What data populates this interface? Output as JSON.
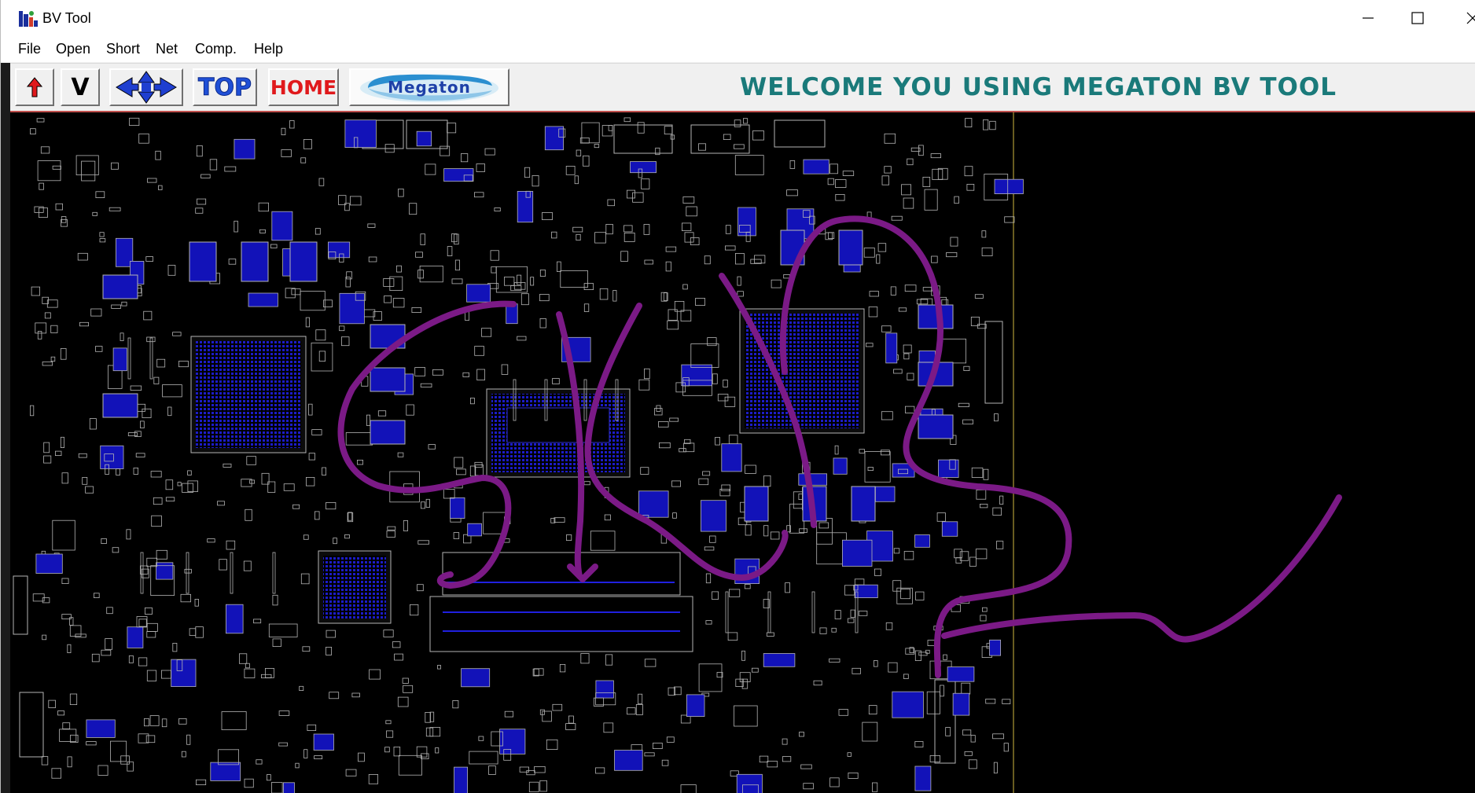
{
  "window": {
    "title": "BV Tool",
    "controls": {
      "minimize": "—",
      "maximize": "☐",
      "close": "✕"
    }
  },
  "menu": [
    "File",
    "Open",
    "Short",
    "Net",
    "Comp.",
    "Help"
  ],
  "toolbar": {
    "up_icon": "up-arrow-icon",
    "v_label": "V",
    "nav_icon": "four-way-arrows-icon",
    "top_label": "TOP",
    "home_label": "HOME",
    "logo_text": "Megaton",
    "welcome": "WELCOME YOU USING MEGATON BV TOOL"
  },
  "colors": {
    "welcome_text": "#1a7a7a",
    "top_label": "#1f4fd6",
    "home_label": "#e0191c",
    "board_outline": "#b5b5b5",
    "component_fill": "#1212b8",
    "board_edge": "#8a7a2a",
    "annotation_stroke": "#7b1a86"
  }
}
